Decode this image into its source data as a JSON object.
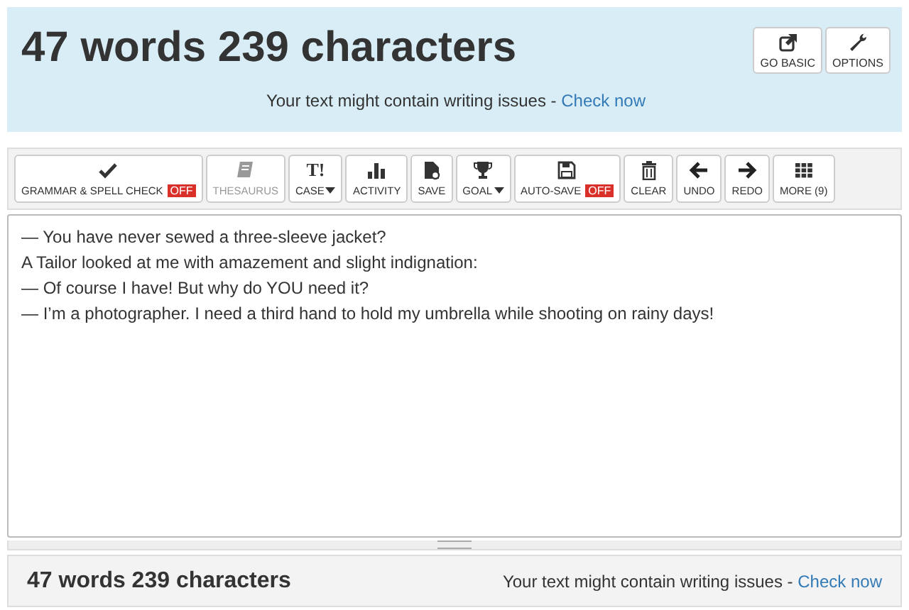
{
  "header": {
    "title": "47 words 239 characters",
    "buttons": [
      {
        "kind": "external",
        "label": "GO BASIC"
      },
      {
        "kind": "wrench",
        "label": "OPTIONS"
      }
    ],
    "notice": {
      "text": "Your text might contain writing issues - ",
      "link": "Check now"
    }
  },
  "toolbar": [
    {
      "kind": "check",
      "label": "GRAMMAR & SPELL CHECK",
      "badge": "OFF",
      "disabled": false,
      "dropdown": false
    },
    {
      "kind": "book",
      "label": "THESAURUS",
      "disabled": true,
      "dropdown": false
    },
    {
      "kind": "case",
      "icon_text": "T!",
      "label": "CASE",
      "disabled": false,
      "dropdown": true
    },
    {
      "kind": "bars",
      "label": "ACTIVITY",
      "disabled": false,
      "dropdown": false
    },
    {
      "kind": "save",
      "label": "SAVE",
      "disabled": false,
      "dropdown": false
    },
    {
      "kind": "trophy",
      "label": "GOAL",
      "disabled": false,
      "dropdown": true
    },
    {
      "kind": "floppy",
      "label": "AUTO-SAVE",
      "badge": "OFF",
      "disabled": false,
      "dropdown": false
    },
    {
      "kind": "trash",
      "label": "CLEAR",
      "disabled": false,
      "dropdown": false
    },
    {
      "kind": "left",
      "label": "UNDO",
      "disabled": false,
      "dropdown": false
    },
    {
      "kind": "right",
      "label": "REDO",
      "disabled": false,
      "dropdown": false
    },
    {
      "kind": "grid",
      "label": "MORE (9)",
      "disabled": false,
      "dropdown": false
    }
  ],
  "editor": {
    "lines": [
      "— You have never sewed a three-sleeve jacket?",
      "A Tailor looked at me with amazement and slight indignation:",
      "— Of course I have! But why do YOU need it?",
      "— I’m a photographer. I need a third hand to hold my umbrella while shooting on rainy days!"
    ]
  },
  "footer": {
    "count": "47 words 239 characters",
    "notice": "Your text might contain writing issues - ",
    "link": "Check now"
  }
}
